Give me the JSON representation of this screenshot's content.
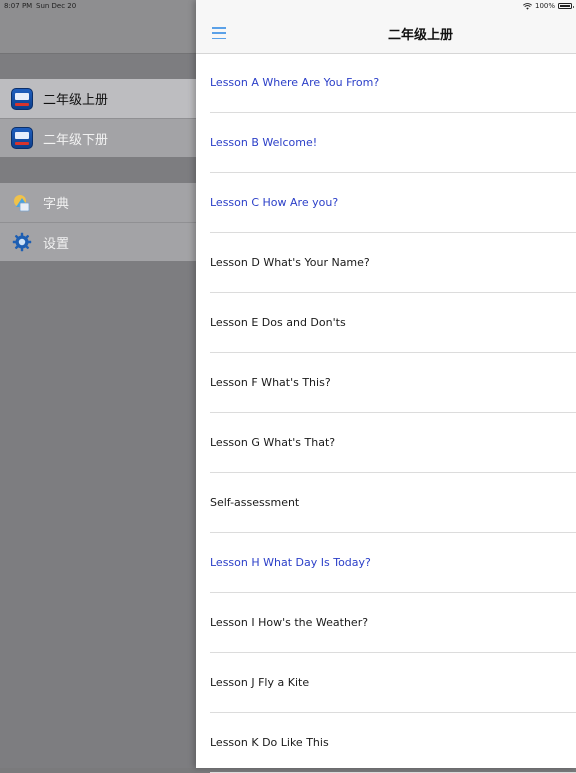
{
  "status_bar": {
    "time": "8:07 PM",
    "date": "Sun Dec 20",
    "battery": "100%"
  },
  "sidebar": {
    "items": [
      {
        "label": "二年级上册",
        "icon": "textbook-icon"
      },
      {
        "label": "二年级下册",
        "icon": "textbook-icon"
      },
      {
        "label": "字典",
        "icon": "dictionary-icon"
      },
      {
        "label": "设置",
        "icon": "gear-icon"
      }
    ]
  },
  "nav": {
    "title": "二年级上册",
    "menu_icon": "hamburger-menu-icon"
  },
  "lessons": [
    {
      "title": "Lesson A Where Are You From?",
      "color": "#2b3fc8"
    },
    {
      "title": "Lesson B Welcome!",
      "color": "#2b3fc8"
    },
    {
      "title": "Lesson C How Are you?",
      "color": "#2b3fc8"
    },
    {
      "title": "Lesson D What's Your Name?",
      "color": "#1a1a1a"
    },
    {
      "title": "Lesson E Dos and Don'ts",
      "color": "#1a1a1a"
    },
    {
      "title": "Lesson F What's This?",
      "color": "#1a1a1a"
    },
    {
      "title": "Lesson G What's That?",
      "color": "#1a1a1a"
    },
    {
      "title": "Self-assessment",
      "color": "#1a1a1a"
    },
    {
      "title": "Lesson H What Day Is Today?",
      "color": "#2b3fc8"
    },
    {
      "title": "Lesson I How's the Weather?",
      "color": "#1a1a1a"
    },
    {
      "title": "Lesson J Fly a Kite",
      "color": "#1a1a1a"
    },
    {
      "title": "Lesson K Do Like This",
      "color": "#1a1a1a"
    }
  ],
  "colors": {
    "accent": "#5ba1e8",
    "link_blue": "#2b3fc8"
  }
}
